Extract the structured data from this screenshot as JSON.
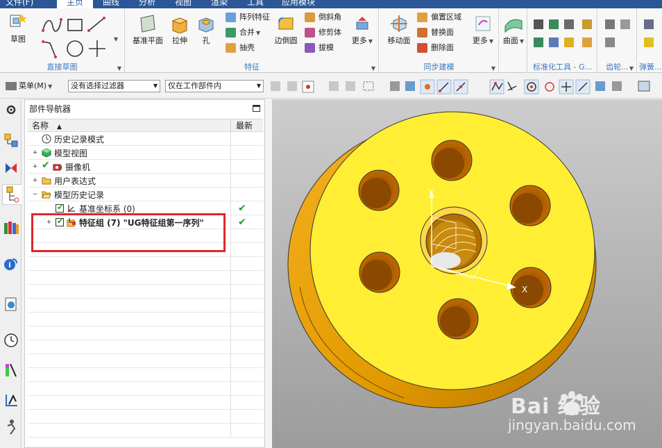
{
  "menu": {
    "tabs": [
      "文件(F)",
      "主页",
      "曲线",
      "分析",
      "视图",
      "渲染",
      "工具",
      "应用模块"
    ],
    "active": "主页"
  },
  "ribbon": {
    "sketch": {
      "big": "草图",
      "label": "直接草图"
    },
    "feature": {
      "label": "特征",
      "datum_plane": "基准平面",
      "extrude": "拉伸",
      "hole": "孔",
      "pattern": "阵列特征",
      "unite": "合并",
      "shell": "抽壳",
      "edge_blend": "边倒圆",
      "chamfer": "倒斜角",
      "trim_body": "修剪体",
      "draft": "拔模",
      "more": "更多"
    },
    "sync": {
      "label": "同步建模",
      "move_face": "移动面",
      "offset_region": "偏置区域",
      "replace_face": "替换面",
      "delete_face": "删除面",
      "more": "更多"
    },
    "surface": {
      "big": "曲面"
    },
    "standard": {
      "label": "标准化工具 - G..."
    },
    "gear": {
      "label": "齿轮..."
    },
    "spring": {
      "label": "弹簧..."
    }
  },
  "toolbar": {
    "menu_button": "菜单(M)",
    "filter_select": "没有选择过滤器",
    "scope_select": "仅在工作部件内"
  },
  "navigator": {
    "title": "部件导航器",
    "col_name": "名称",
    "col_new": "最新",
    "rows": [
      {
        "text": "历史记录模式"
      },
      {
        "text": "模型视图"
      },
      {
        "text": "摄像机"
      },
      {
        "text": "用户表达式"
      },
      {
        "text": "模型历史记录"
      },
      {
        "text": "基准坐标系 (0)"
      },
      {
        "text": "特征组 (7) \"UG特征组第一序列\""
      }
    ]
  },
  "viewport": {
    "axis_y": "Y",
    "axis_x": "X"
  },
  "watermark": {
    "brand": "Bai 经验",
    "url": "jingyan.baidu.com"
  },
  "colors": {
    "menubar": "#2b5797",
    "part_top": "#ffee33",
    "part_side": "#e8a100",
    "highlight": "#e0262c",
    "check": "#1b9e1b"
  }
}
